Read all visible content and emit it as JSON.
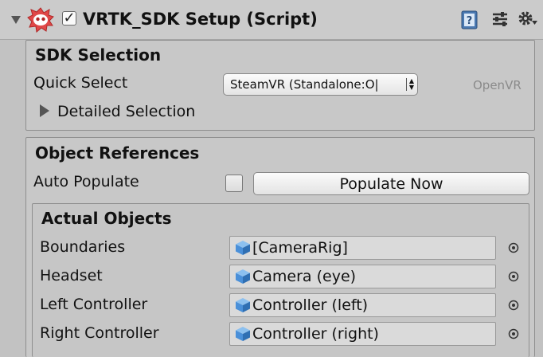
{
  "header": {
    "title": "VRTK_SDK Setup (Script)",
    "enabled": true,
    "icons": [
      "foldout-arrow-icon",
      "script-logo-icon",
      "help-book-icon",
      "presets-icon",
      "gear-icon"
    ]
  },
  "sdk_selection": {
    "title": "SDK Selection",
    "quick_select_label": "Quick Select",
    "quick_select_value": "SteamVR (Standalone:O|",
    "hint": "OpenVR",
    "detailed_selection_label": "Detailed Selection"
  },
  "object_references": {
    "title": "Object References",
    "auto_populate_label": "Auto Populate",
    "auto_populate_checked": false,
    "populate_now_label": "Populate Now"
  },
  "actual_objects": {
    "title": "Actual Objects",
    "rows": [
      {
        "label": "Boundaries",
        "value": "[CameraRig]"
      },
      {
        "label": "Headset",
        "value": "Camera (eye)"
      },
      {
        "label": "Left Controller",
        "value": "Controller (left)"
      },
      {
        "label": "Right Controller",
        "value": "Controller (right)"
      }
    ]
  },
  "colors": {
    "background": "#c2c2c2",
    "cube_icon": "#4a90d9"
  }
}
